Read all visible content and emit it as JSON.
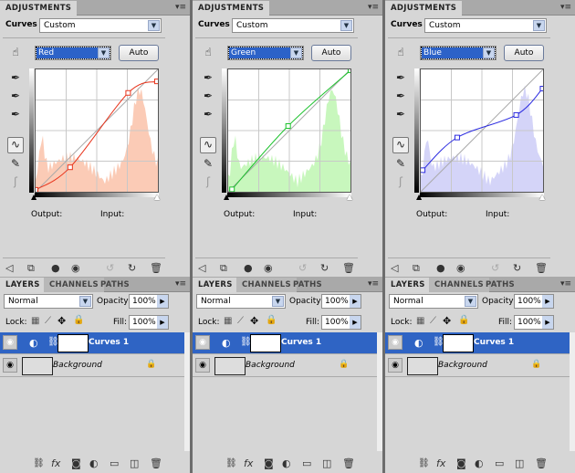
{
  "panels": [
    {
      "channel": "Red",
      "color": "#e8341c",
      "hist": "#fbcbb6",
      "points": [
        [
          0,
          4
        ],
        [
          72,
          51
        ],
        [
          193,
          206
        ],
        [
          253,
          230
        ]
      ]
    },
    {
      "channel": "Green",
      "color": "#1cc22c",
      "hist": "#c8f7bd",
      "points": [
        [
          8,
          5
        ],
        [
          125,
          137
        ],
        [
          255,
          253
        ]
      ]
    },
    {
      "channel": "Blue",
      "color": "#2a2ae0",
      "hist": "#d4d4f8",
      "points": [
        [
          4,
          45
        ],
        [
          76,
          113
        ],
        [
          199,
          160
        ],
        [
          254,
          215
        ]
      ]
    }
  ],
  "adjustments": {
    "tab": "ADJUSTMENTS",
    "curves_label": "Curves",
    "preset": "Custom",
    "auto": "Auto",
    "output": "Output:",
    "input": "Input:"
  },
  "layers": {
    "tabs": [
      "LAYERS",
      "CHANNELS",
      "PATHS"
    ],
    "blend": "Normal",
    "opacity_label": "Opacity:",
    "opacity": "100%",
    "lock_label": "Lock:",
    "fill_label": "Fill:",
    "fill": "100%",
    "items": [
      {
        "name": "Curves 1",
        "selected": true
      },
      {
        "name": "Background",
        "locked": true
      }
    ]
  }
}
